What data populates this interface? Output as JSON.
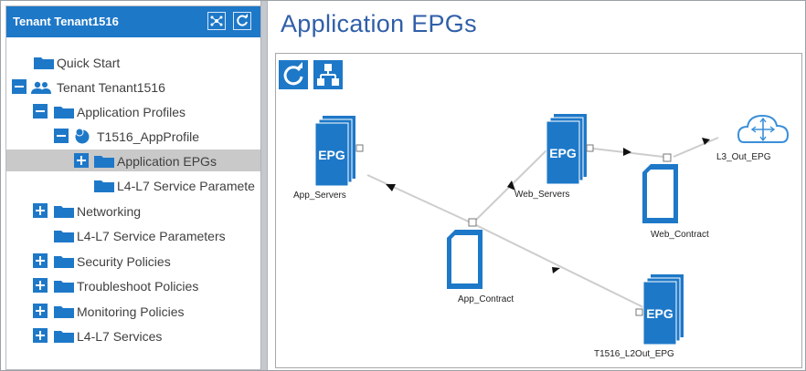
{
  "left_panel": {
    "title": "Tenant Tenant1516",
    "tree": [
      {
        "label": "Quick Start"
      },
      {
        "label": "Tenant Tenant1516"
      },
      {
        "label": "Application Profiles"
      },
      {
        "label": "T1516_AppProfile"
      },
      {
        "label": "Application EPGs"
      },
      {
        "label": "L4-L7 Service Paramete"
      },
      {
        "label": "Networking"
      },
      {
        "label": "L4-L7 Service Parameters"
      },
      {
        "label": "Security Policies"
      },
      {
        "label": "Troubleshoot Policies"
      },
      {
        "label": "Monitoring Policies"
      },
      {
        "label": "L4-L7 Services"
      }
    ]
  },
  "main": {
    "title": "Application EPGs",
    "diagram": {
      "epg_text": "EPG",
      "nodes": {
        "app_servers": "App_Servers",
        "web_servers": "Web_Servers",
        "app_contract": "App_Contract",
        "web_contract": "Web_Contract",
        "l2out_epg": "T1516_L2Out_EPG",
        "l3_out_epg": "L3_Out_EPG"
      }
    }
  },
  "colors": {
    "accent": "#1e78c8",
    "title": "#2f5fa8",
    "selected_row": "#c9c9c9"
  }
}
